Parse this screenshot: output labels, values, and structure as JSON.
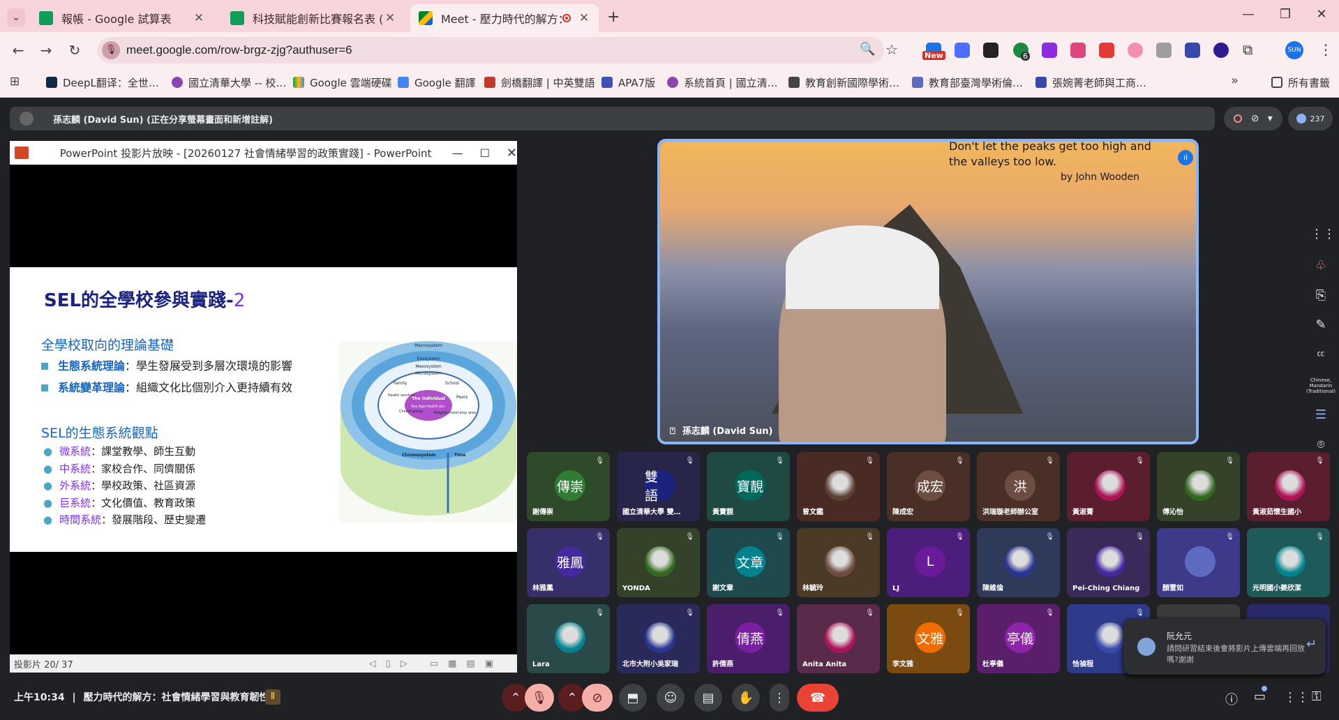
{
  "browser": {
    "tabs": [
      {
        "title": "報帳 - Google 試算表"
      },
      {
        "title": "科技賦能創新比賽報名表 (回覆)"
      },
      {
        "title": "Meet - 壓力時代的解方：社"
      }
    ],
    "url": "meet.google.com/row-brgz-zjg?authuser=6",
    "profile_label": "SUN",
    "new_badge": "New",
    "ext_badge": "6",
    "bookmarks": [
      "DeepL翻译：全世…",
      "國立清華大學 -- 校…",
      "Google 雲端硬碟",
      "Google 翻譯",
      "劍橋翻譯 | 中英雙語",
      "APA7版",
      "系統首頁 | 國立清…",
      "教育創新國際學術…",
      "教育部臺灣學術倫…",
      "張婉菁老師與工商…",
      "所有書籤"
    ]
  },
  "meet": {
    "presenter_banner": "孫志麟 (David Sun) (正在分享螢幕畫面和新增註解)",
    "participant_count": "237",
    "ppt_window_title": "PowerPoint 投影片放映 - [20260127 社會情緒學習的政策實踐] - PowerPoint",
    "slide": {
      "title_main": "SEL的全學校參與實踐-",
      "title_num": "2",
      "h1": "全學校取向的理論基礎",
      "b1_key": "生態系統理論",
      "b1_text": "：學生發展受到多層次環境的影響",
      "b2_key": "系統變革理論",
      "b2_text": "：組織文化比個別介入更持續有效",
      "h2": "SEL的生態系統觀點",
      "items": [
        {
          "key": "微系統",
          "text": "：課堂教學、師生互動"
        },
        {
          "key": "中系統",
          "text": "：家校合作、同儕關係"
        },
        {
          "key": "外系統",
          "text": "：學校政策、社區資源"
        },
        {
          "key": "巨系統",
          "text": "：文化價值、教育政策"
        },
        {
          "key": "時間系統",
          "text": "：發展階段、歷史變遷"
        }
      ],
      "diagram": {
        "macro": "Macrosystem",
        "exo": "Exosystem",
        "meso": "Mesosystem",
        "micro": "Microsystem",
        "center": "The individual",
        "center_sub": "Sex Age Health etc.",
        "family": "Family",
        "school": "School",
        "peers": "Peers",
        "health": "Health services",
        "church": "Church group",
        "neighborhood": "Neighborhood play area",
        "chrono": "Chronosystem",
        "time": "Time"
      }
    },
    "slide_counter": "投影片 20/ 37",
    "speaker_quote_1": "Don't let the peaks get too high and",
    "speaker_quote_2": "the valleys too low.",
    "speaker_quote_by": "by John Wooden",
    "speaker_name": "孫志麟 (David Sun)",
    "participants": [
      {
        "name": "謝傳崇",
        "initials": "傳崇",
        "color": "#2e7d32",
        "bg": "#2f4a2a",
        "pic": false
      },
      {
        "name": "國立清華大學 雙…",
        "initials": "雙 語",
        "color": "#1a237e",
        "bg": "#27264a",
        "pic": false
      },
      {
        "name": "黃寶靚",
        "initials": "寶靚",
        "color": "#00695c",
        "bg": "#1f4a43",
        "pic": false
      },
      {
        "name": "曾文鑑",
        "initials": "",
        "color": "#5d4037",
        "bg": "#4a2b24",
        "pic": true
      },
      {
        "name": "陳成宏",
        "initials": "成宏",
        "color": "#6d4c41",
        "bg": "#4a2f26",
        "pic": false
      },
      {
        "name": "洪瑞璇老師辦公室",
        "initials": "洪",
        "color": "#6d4c41",
        "bg": "#4a2f26",
        "pic": false
      },
      {
        "name": "黃淑菁",
        "initials": "",
        "color": "#ad1457",
        "bg": "#5a1e2e",
        "pic": true
      },
      {
        "name": "傅沁怡",
        "initials": "",
        "color": "#33691e",
        "bg": "#34422a",
        "pic": true
      },
      {
        "name": "黃淑茹懷生國小",
        "initials": "",
        "color": "#ad1457",
        "bg": "#5a1e2e",
        "pic": true
      },
      {
        "name": "林雅鳳",
        "initials": "雅鳳",
        "color": "#4527a0",
        "bg": "#36306a",
        "pic": false
      },
      {
        "name": "YONDA",
        "initials": "",
        "color": "#33691e",
        "bg": "#34422a",
        "pic": true
      },
      {
        "name": "謝文章",
        "initials": "文章",
        "color": "#00838f",
        "bg": "#1e4a4e",
        "pic": false
      },
      {
        "name": "林毓玲",
        "initials": "",
        "color": "#6d4c41",
        "bg": "#4a3a26",
        "pic": true
      },
      {
        "name": "LJ",
        "initials": "L",
        "color": "#6a1b9a",
        "bg": "#4a1e7a",
        "pic": false
      },
      {
        "name": "陳維倫",
        "initials": "",
        "color": "#283593",
        "bg": "#2e3a5a",
        "pic": true
      },
      {
        "name": "Pei-Ching Chiang",
        "initials": "",
        "color": "#4527a0",
        "bg": "#3a2a5a",
        "pic": true
      },
      {
        "name": "顏雪如",
        "initials": "",
        "color": "#5c6bc0",
        "bg": "#3d3a8a",
        "pic": false
      },
      {
        "name": "光明國小姜欣潔",
        "initials": "",
        "color": "#00838f",
        "bg": "#1e5a5a",
        "pic": true
      },
      {
        "name": "Lara",
        "initials": "",
        "color": "#00838f",
        "bg": "#2a4a4a",
        "pic": true
      },
      {
        "name": "北市大附小吳家瑞",
        "initials": "",
        "color": "#283593",
        "bg": "#2a2a5a",
        "pic": true
      },
      {
        "name": "許倩燕",
        "initials": "倩燕",
        "color": "#7b1fa2",
        "bg": "#4a1e6a",
        "pic": false
      },
      {
        "name": "Anita Anita",
        "initials": "",
        "color": "#ad1457",
        "bg": "#5a2a4a",
        "pic": true
      },
      {
        "name": "李文雅",
        "initials": "文雅",
        "color": "#ef6c00",
        "bg": "#7a4a10",
        "pic": false
      },
      {
        "name": "杜亭儀",
        "initials": "亭儀",
        "color": "#8e24aa",
        "bg": "#5a1e6a",
        "pic": false
      },
      {
        "name": "恰禎程",
        "initials": "",
        "color": "#3949ab",
        "bg": "#2e3a8a",
        "pic": true
      }
    ],
    "chat_popup": {
      "sender": "阮允元",
      "message": "請問研習結束後會將影片上傳雲端再回放嗎?謝謝"
    },
    "rail_caption": "Chinese, Mandarin (Traditional)",
    "bottom": {
      "time": "上午10:34",
      "separator": "|",
      "meeting_title": "壓力時代的解方：社會情緒學習與教育韌性"
    }
  }
}
